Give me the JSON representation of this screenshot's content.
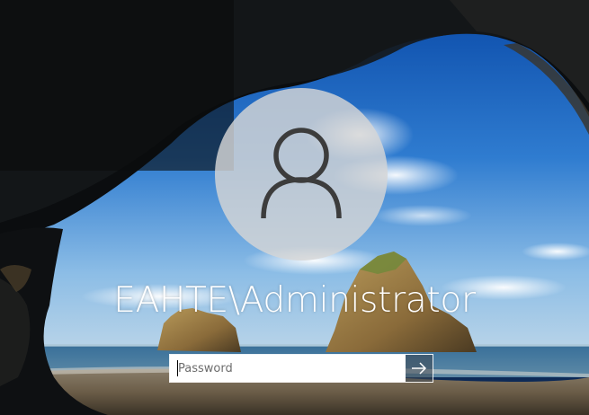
{
  "login": {
    "username": "EAHTE\\Administrator",
    "password": {
      "placeholder": "Password",
      "value": ""
    },
    "submit_icon": "arrow-right-icon",
    "avatar_icon": "user-silhouette-icon"
  },
  "colors": {
    "text": "#ffffff",
    "avatar_bg": "#d6d6d6",
    "avatar_glyph": "#3c3c3c",
    "input_bg": "#ffffff",
    "placeholder": "#6d6d6d"
  }
}
